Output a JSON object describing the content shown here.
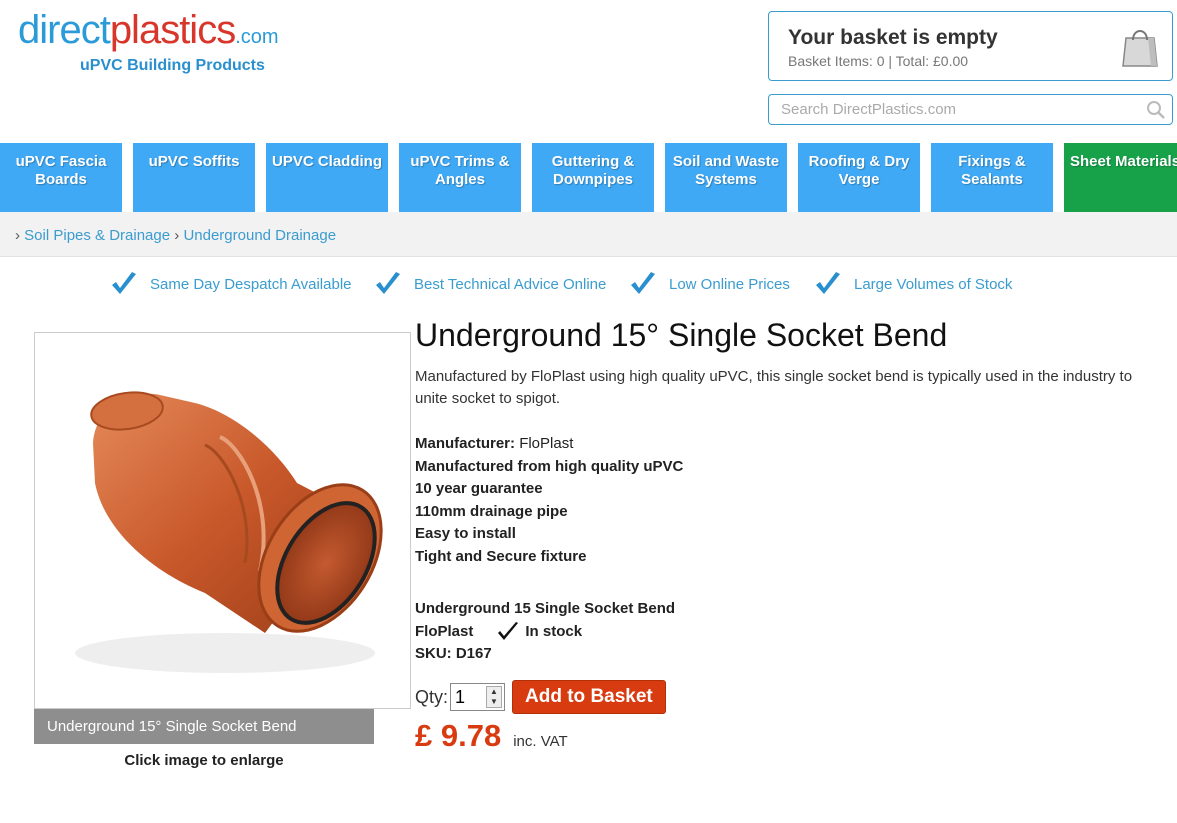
{
  "logo": {
    "part1": "direct",
    "part2": "plastics",
    "part3": ".com",
    "tagline": "uPVC Building Products"
  },
  "basket": {
    "title": "Your basket is empty",
    "summary": "Basket Items: 0 | Total: £0.00",
    "icon": "shopping-bag-icon"
  },
  "search": {
    "placeholder": "Search DirectPlastics.com",
    "icon": "search-icon"
  },
  "nav": {
    "items": [
      {
        "label": "uPVC Fascia Boards"
      },
      {
        "label": "uPVC Soffits"
      },
      {
        "label": "UPVC Cladding"
      },
      {
        "label": "uPVC Trims & Angles"
      },
      {
        "label": "Guttering & Downpipes"
      },
      {
        "label": "Soil and Waste Systems"
      },
      {
        "label": "Roofing & Dry Verge"
      },
      {
        "label": "Fixings & Sealants"
      },
      {
        "label": "Sheet Materials"
      }
    ],
    "colors": {
      "default": "#3fa9f5",
      "highlight": "#17a24a"
    }
  },
  "breadcrumb": {
    "sep": "›",
    "items": [
      "Soil Pipes & Drainage",
      "Underground Drainage"
    ]
  },
  "usp": [
    "Same Day Despatch Available",
    "Best Technical Advice Online",
    "Low Online Prices",
    "Large Volumes of Stock"
  ],
  "product": {
    "title": "Underground 15° Single Socket Bend",
    "description": "Manufactured by FloPlast using high quality uPVC, this single socket bend is typically used in the industry to unite socket to spigot.",
    "manufacturer_label": "Manufacturer:",
    "manufacturer": "FloPlast",
    "features": [
      "Manufactured from high quality uPVC",
      "10 year guarantee",
      "110mm drainage pipe",
      "Easy to install",
      "Tight and Secure fixture"
    ],
    "name_line": "Underground 15 Single Socket Bend",
    "brand": "FloPlast",
    "stock": "In stock",
    "sku": "SKU: D167",
    "image_caption": "Underground 15° Single Socket Bend",
    "enlarge_hint": "Click image to enlarge",
    "qty_label": "Qty:",
    "qty_value": "1",
    "add_button": "Add to Basket",
    "price": "£ 9.78",
    "vat": "inc. VAT",
    "accent_color": "#d83b10"
  }
}
